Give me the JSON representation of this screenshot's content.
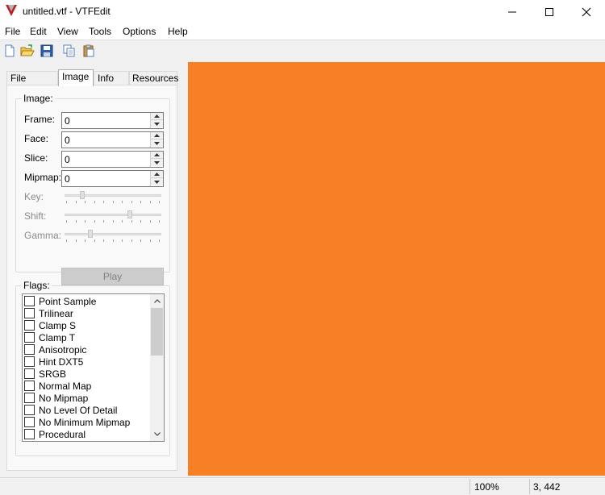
{
  "window": {
    "title": "untitled.vtf - VTFEdit"
  },
  "menu": [
    "File",
    "Edit",
    "View",
    "Tools",
    "Options",
    "Help"
  ],
  "toolbar": {
    "icons": [
      "new-file-icon",
      "open-folder-icon",
      "save-icon",
      "copy-icon",
      "paste-icon"
    ]
  },
  "tabs": [
    "File System",
    "Image",
    "Info",
    "Resources"
  ],
  "image_group": {
    "title": "Image:",
    "fields": [
      {
        "label": "Frame:",
        "value": "0"
      },
      {
        "label": "Face:",
        "value": "0"
      },
      {
        "label": "Slice:",
        "value": "0"
      },
      {
        "label": "Mipmap:",
        "value": "0"
      }
    ],
    "sliders": [
      {
        "label": "Key:",
        "level": 0.17
      },
      {
        "label": "Shift:",
        "level": 0.68
      },
      {
        "label": "Gamma:",
        "level": 0.25
      }
    ],
    "play_label": "Play"
  },
  "flags_group": {
    "title": "Flags:",
    "items": [
      "Point Sample",
      "Trilinear",
      "Clamp S",
      "Clamp T",
      "Anisotropic",
      "Hint DXT5",
      "SRGB",
      "Normal Map",
      "No Mipmap",
      "No Level Of Detail",
      "No Minimum Mipmap",
      "Procedural"
    ]
  },
  "preview": {
    "color": "#f78026"
  },
  "status": {
    "zoom": "100%",
    "coords": "3, 442"
  }
}
